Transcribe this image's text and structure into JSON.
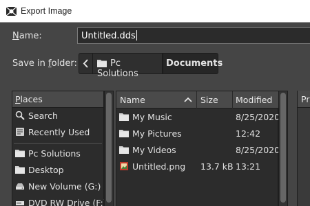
{
  "window": {
    "title": "Export Image",
    "icon": "gimp-export-icon"
  },
  "name_row": {
    "label_u": "N",
    "label_rest": "ame:",
    "value": "Untitled.dds"
  },
  "folder_row": {
    "label_before": "Save in ",
    "label_u": "f",
    "label_after": "older:",
    "back_icon": "chevron-left-icon",
    "crumbs": [
      "Pc Solutions",
      "Documents"
    ]
  },
  "places": {
    "header_u": "P",
    "header_rest": "laces",
    "items": [
      {
        "label": "Search",
        "icon": "search-icon"
      },
      {
        "label": "Recently Used",
        "icon": "recent-icon"
      },
      {
        "label": "Pc Solutions",
        "icon": "folder-icon"
      },
      {
        "label": "Desktop",
        "icon": "folder-icon"
      },
      {
        "label": "New Volume (G:)",
        "icon": "drive-icon"
      },
      {
        "label": "DVD RW Drive (F:)",
        "icon": "optical-drive-icon"
      }
    ]
  },
  "files": {
    "columns": {
      "name": "Name",
      "size": "Size",
      "modified": "Modified"
    },
    "sort": "ascending",
    "rows": [
      {
        "name": "My Music",
        "size": "",
        "modified": "8/25/2020",
        "icon": "folder-icon"
      },
      {
        "name": "My Pictures",
        "size": "",
        "modified": "12:42",
        "icon": "folder-icon"
      },
      {
        "name": "My Videos",
        "size": "",
        "modified": "8/25/2020",
        "icon": "folder-icon"
      },
      {
        "name": "Untitled.png",
        "size": "13.7 kB",
        "modified": "13:21",
        "icon": "image-file-icon"
      }
    ]
  },
  "preview": {
    "header": "Pr"
  },
  "colors": {
    "background": "#454545",
    "panel": "#2c2c2c",
    "header": "#4a4a4a",
    "folder": "#d4d4d4",
    "accent_image": "#c0392b"
  }
}
